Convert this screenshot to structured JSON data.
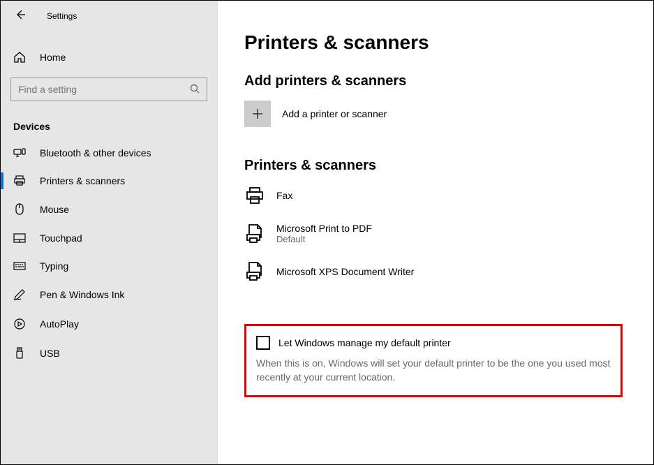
{
  "app_title": "Settings",
  "home_label": "Home",
  "search_placeholder": "Find a setting",
  "section_label": "Devices",
  "nav": [
    {
      "label": "Bluetooth & other devices"
    },
    {
      "label": "Printers & scanners"
    },
    {
      "label": "Mouse"
    },
    {
      "label": "Touchpad"
    },
    {
      "label": "Typing"
    },
    {
      "label": "Pen & Windows Ink"
    },
    {
      "label": "AutoPlay"
    },
    {
      "label": "USB"
    }
  ],
  "page_title": "Printers & scanners",
  "add_heading": "Add printers & scanners",
  "add_label": "Add a printer or scanner",
  "list_heading": "Printers & scanners",
  "printers": [
    {
      "name": "Fax",
      "status": ""
    },
    {
      "name": "Microsoft Print to PDF",
      "status": "Default"
    },
    {
      "name": "Microsoft XPS Document Writer",
      "status": ""
    }
  ],
  "checkbox_label": "Let Windows manage my default printer",
  "checkbox_desc": "When this is on, Windows will set your default printer to be the one you used most recently at your current location."
}
